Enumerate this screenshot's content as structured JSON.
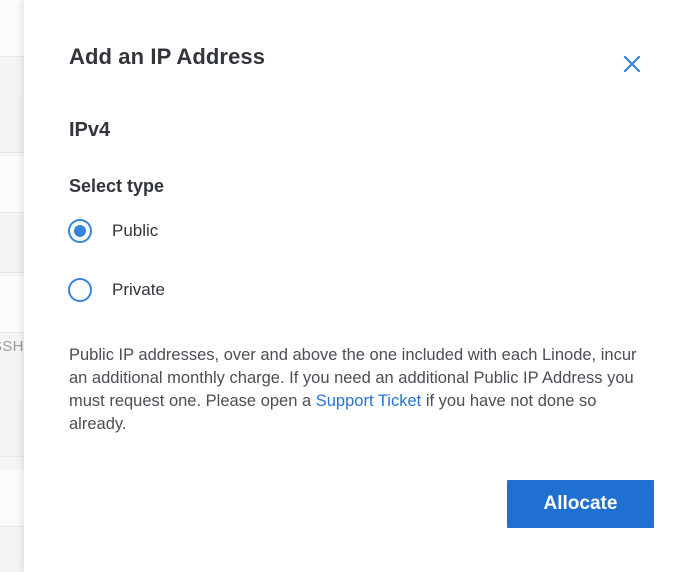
{
  "background": {
    "partial_text": "SSH"
  },
  "drawer": {
    "title": "Add an IP Address",
    "close_icon": "close-icon",
    "section_heading": "IPv4",
    "type_field": {
      "label": "Select type",
      "options": [
        {
          "label": "Public",
          "selected": true
        },
        {
          "label": "Private",
          "selected": false
        }
      ]
    },
    "help": {
      "text_before_link": "Public IP addresses, over and above the one included with each Linode, incur an additional monthly charge. If you need an additional Public IP Address you must request one. Please open a ",
      "link_text": "Support Ticket",
      "text_after_link": " if you have not done so already."
    },
    "allocate_label": "Allocate"
  },
  "colors": {
    "accent": "#3683dc",
    "button": "#1f70d1",
    "link": "#2575d0",
    "text": "#32363c"
  }
}
